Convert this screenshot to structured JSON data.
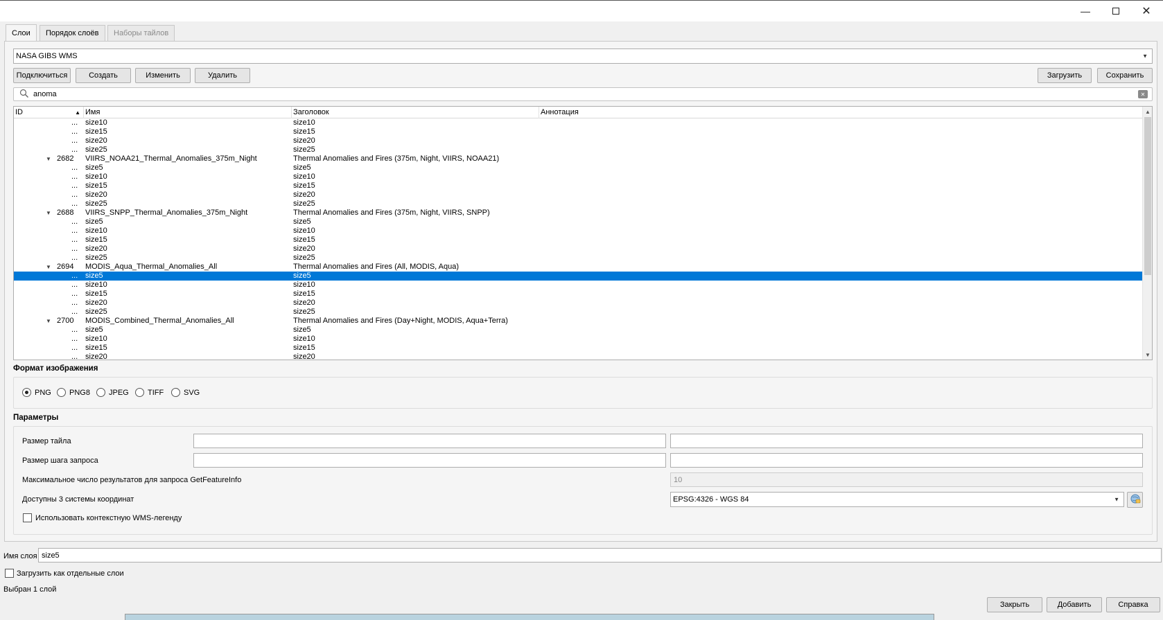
{
  "window": {
    "minimize_icon": "minimize-icon",
    "maximize_icon": "maximize-icon",
    "close_icon": "close-icon"
  },
  "tabs": [
    {
      "label": "Слои"
    },
    {
      "label": "Порядок слоёв"
    },
    {
      "label": "Наборы тайлов"
    }
  ],
  "connection": {
    "selected": "NASA GIBS WMS",
    "buttons": {
      "connect": "Подключиться",
      "create": "Создать",
      "edit": "Изменить",
      "delete": "Удалить",
      "load": "Загрузить",
      "save": "Сохранить"
    }
  },
  "search": {
    "value": "anoma"
  },
  "tree": {
    "headers": {
      "id": "ID",
      "name": "Имя",
      "title": "Заголовок",
      "abstract": "Аннотация"
    },
    "rows": [
      {
        "dots": "...",
        "name": "size10",
        "title": "size10"
      },
      {
        "dots": "...",
        "name": "size15",
        "title": "size15"
      },
      {
        "dots": "...",
        "name": "size20",
        "title": "size20"
      },
      {
        "dots": "...",
        "name": "size25",
        "title": "size25"
      },
      {
        "toggle": "▼",
        "id": "2682",
        "name": "VIIRS_NOAA21_Thermal_Anomalies_375m_Night",
        "title": "Thermal Anomalies and Fires (375m, Night, VIIRS, NOAA21)"
      },
      {
        "dots": "...",
        "name": "size5",
        "title": "size5"
      },
      {
        "dots": "...",
        "name": "size10",
        "title": "size10"
      },
      {
        "dots": "...",
        "name": "size15",
        "title": "size15"
      },
      {
        "dots": "...",
        "name": "size20",
        "title": "size20"
      },
      {
        "dots": "...",
        "name": "size25",
        "title": "size25"
      },
      {
        "toggle": "▼",
        "id": "2688",
        "name": "VIIRS_SNPP_Thermal_Anomalies_375m_Night",
        "title": "Thermal Anomalies and Fires (375m, Night, VIIRS, SNPP)"
      },
      {
        "dots": "...",
        "name": "size5",
        "title": "size5"
      },
      {
        "dots": "...",
        "name": "size10",
        "title": "size10"
      },
      {
        "dots": "...",
        "name": "size15",
        "title": "size15"
      },
      {
        "dots": "...",
        "name": "size20",
        "title": "size20"
      },
      {
        "dots": "...",
        "name": "size25",
        "title": "size25"
      },
      {
        "toggle": "▼",
        "id": "2694",
        "name": "MODIS_Aqua_Thermal_Anomalies_All",
        "title": "Thermal Anomalies and Fires (All, MODIS, Aqua)"
      },
      {
        "dots": "...",
        "name": "size5",
        "title": "size5",
        "selected": true
      },
      {
        "dots": "...",
        "name": "size10",
        "title": "size10"
      },
      {
        "dots": "...",
        "name": "size15",
        "title": "size15"
      },
      {
        "dots": "...",
        "name": "size20",
        "title": "size20"
      },
      {
        "dots": "...",
        "name": "size25",
        "title": "size25"
      },
      {
        "toggle": "▼",
        "id": "2700",
        "name": "MODIS_Combined_Thermal_Anomalies_All",
        "title": "Thermal Anomalies and Fires (Day+Night, MODIS, Aqua+Terra)"
      },
      {
        "dots": "...",
        "name": "size5",
        "title": "size5"
      },
      {
        "dots": "...",
        "name": "size10",
        "title": "size10"
      },
      {
        "dots": "...",
        "name": "size15",
        "title": "size15"
      },
      {
        "dots": "...",
        "name": "size20",
        "title": "size20"
      }
    ]
  },
  "image_format": {
    "title": "Формат изображения",
    "options": [
      {
        "label": "PNG",
        "checked": true
      },
      {
        "label": "PNG8",
        "checked": false
      },
      {
        "label": "JPEG",
        "checked": false
      },
      {
        "label": "TIFF",
        "checked": false
      },
      {
        "label": "SVG",
        "checked": false
      }
    ]
  },
  "params": {
    "title": "Параметры",
    "tile_size_label": "Размер тайла",
    "step_size_label": "Размер шага запроса",
    "max_features_label": "Максимальное число результатов для запроса GetFeatureInfo",
    "max_features_value": "10",
    "crs_label": "Доступны 3 системы координат",
    "crs_value": "EPSG:4326 - WGS 84",
    "contextual_legend_label": "Использовать контекстную WMS-легенду"
  },
  "layer_name": {
    "label": "Имя слоя",
    "value": "size5"
  },
  "load_separately_label": "Загрузить как отдельные слои",
  "status": "Выбран 1 слой",
  "footer_buttons": {
    "close": "Закрыть",
    "add": "Добавить",
    "help": "Справка"
  }
}
